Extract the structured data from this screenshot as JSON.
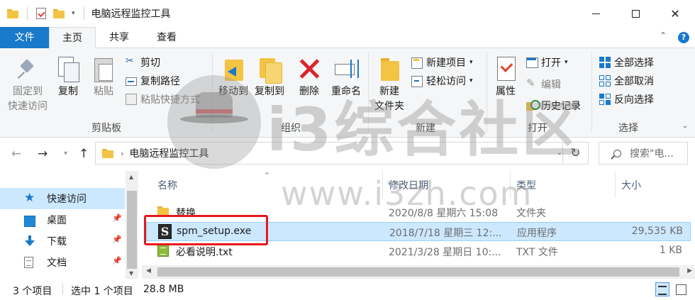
{
  "window": {
    "title": "电脑远程监控工具"
  },
  "tabs": {
    "file": "文件",
    "home": "主页",
    "share": "共享",
    "view": "查看",
    "help": "?"
  },
  "ribbon": {
    "clipboard": {
      "group_label": "剪贴板",
      "pin": "固定到\n快速访问",
      "pin_line1": "固定到",
      "pin_line2": "快速访问",
      "copy": "复制",
      "paste": "粘贴",
      "cut": "剪切",
      "copy_path": "复制路径",
      "paste_shortcut": "粘贴快捷方式"
    },
    "organize": {
      "group_label": "组织",
      "move_to": "移动到",
      "copy_to": "复制到",
      "delete": "删除",
      "rename": "重命名"
    },
    "new": {
      "group_label": "新建",
      "new_folder_line1": "新建",
      "new_folder_line2": "文件夹",
      "new_item": "新建项目",
      "easy_access": "轻松访问"
    },
    "open": {
      "group_label": "打开",
      "properties": "属性",
      "open": "打开",
      "edit": "编辑",
      "history": "历史记录"
    },
    "select": {
      "group_label": "选择",
      "select_all": "全部选择",
      "select_none": "全部取消",
      "invert": "反向选择"
    }
  },
  "address": {
    "path": "电脑远程监控工具",
    "search_placeholder": "搜索\"电..."
  },
  "nav_pane": {
    "items": [
      {
        "label": "快速访问",
        "icon": "star-icon"
      },
      {
        "label": "桌面",
        "icon": "desktop-icon"
      },
      {
        "label": "下载",
        "icon": "download-icon"
      },
      {
        "label": "文档",
        "icon": "document-icon"
      }
    ]
  },
  "columns": {
    "name": "名称",
    "date": "修改日期",
    "type": "类型",
    "size": "大小"
  },
  "files": [
    {
      "name": "替换",
      "date": "2020/8/8 星期六 15:08",
      "type": "文件夹",
      "size": "",
      "icon": "folder-icon"
    },
    {
      "name": "spm_setup.exe",
      "date": "2018/7/18 星期三 12:...",
      "type": "应用程序",
      "size": "29,535 KB",
      "icon": "exe-icon",
      "selected": true
    },
    {
      "name": "必看说明.txt",
      "date": "2021/3/28 星期日 10:...",
      "type": "TXT 文件",
      "size": "1 KB",
      "icon": "txt-icon"
    }
  ],
  "status": {
    "count": "3 个项目",
    "selection": "选中 1 个项目",
    "size": "28.8 MB"
  },
  "watermark": {
    "text": "i3综合社区",
    "url": "www.i3zh.com"
  },
  "colors": {
    "accent": "#1979ca",
    "selection": "#cce8ff",
    "highlight_box": "#e5191e"
  }
}
